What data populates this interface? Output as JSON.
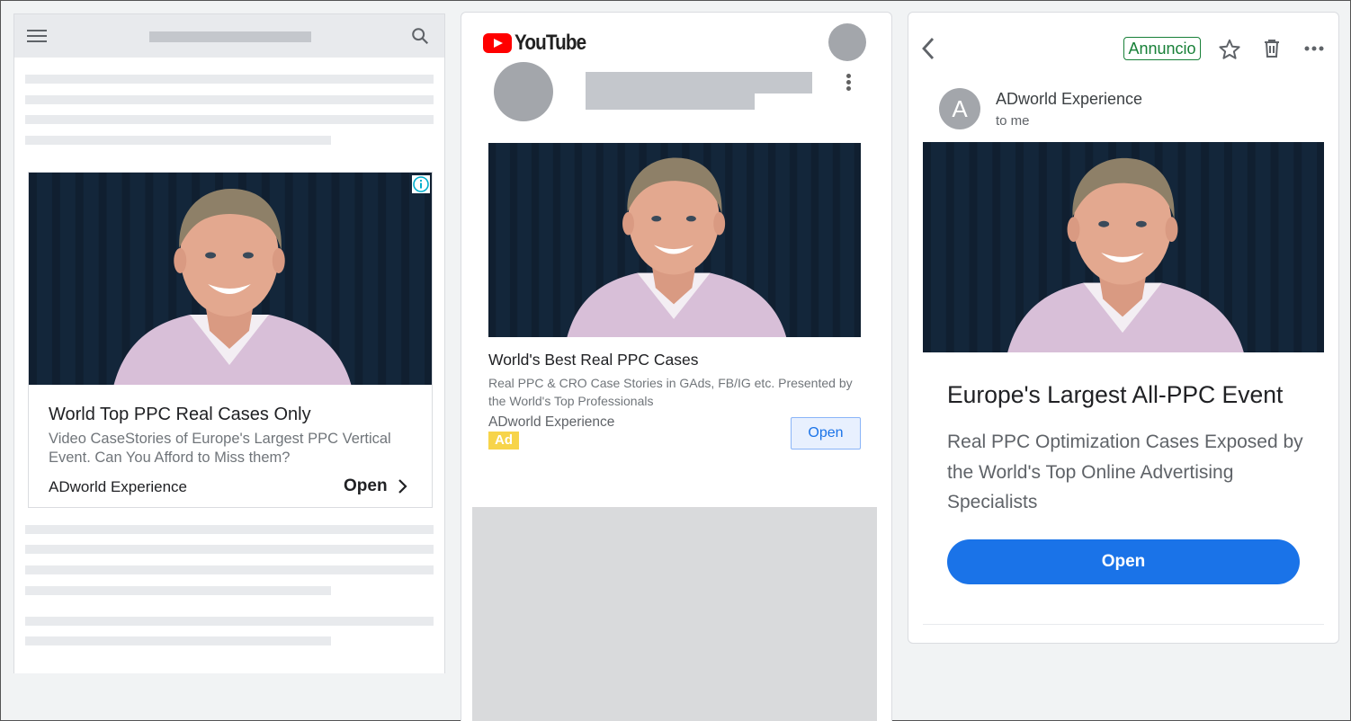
{
  "display_ad": {
    "title": "World Top PPC Real Cases Only",
    "description": "Video CaseStories of Europe's Largest PPC Vertical Event. Can You Afford to Miss them?",
    "advertiser": "ADworld Experience",
    "open_label": "Open",
    "icons": {
      "menu": "hamburger-icon",
      "search": "search-icon",
      "adchoices": "info-icon",
      "chevron": "chevron-right-icon"
    }
  },
  "youtube_ad": {
    "logo_text": "YouTube",
    "title": "World's Best Real PPC Cases",
    "description": "Real PPC & CRO Case Stories in GAds, FB/IG etc. Presented by the World's Top Professionals",
    "advertiser": "ADworld Experience",
    "ad_badge": "Ad",
    "open_label": "Open",
    "colors": {
      "brand_red": "#ff0000",
      "badge_yellow": "#f7d44a"
    }
  },
  "gmail_ad": {
    "badge": "Annuncio",
    "avatar_letter": "A",
    "sender": "ADworld Experience",
    "recipient": "to me",
    "title": "Europe's Largest All-PPC Event",
    "description": "Real PPC Optimization Cases Exposed by the World's Top Online Advertising Specialists",
    "open_label": "Open",
    "colors": {
      "button_blue": "#1a73e8",
      "badge_green": "#188038"
    },
    "icons": {
      "back": "back-arrow-icon",
      "star": "star-icon",
      "delete": "trash-icon",
      "more": "more-horiz-icon"
    }
  }
}
